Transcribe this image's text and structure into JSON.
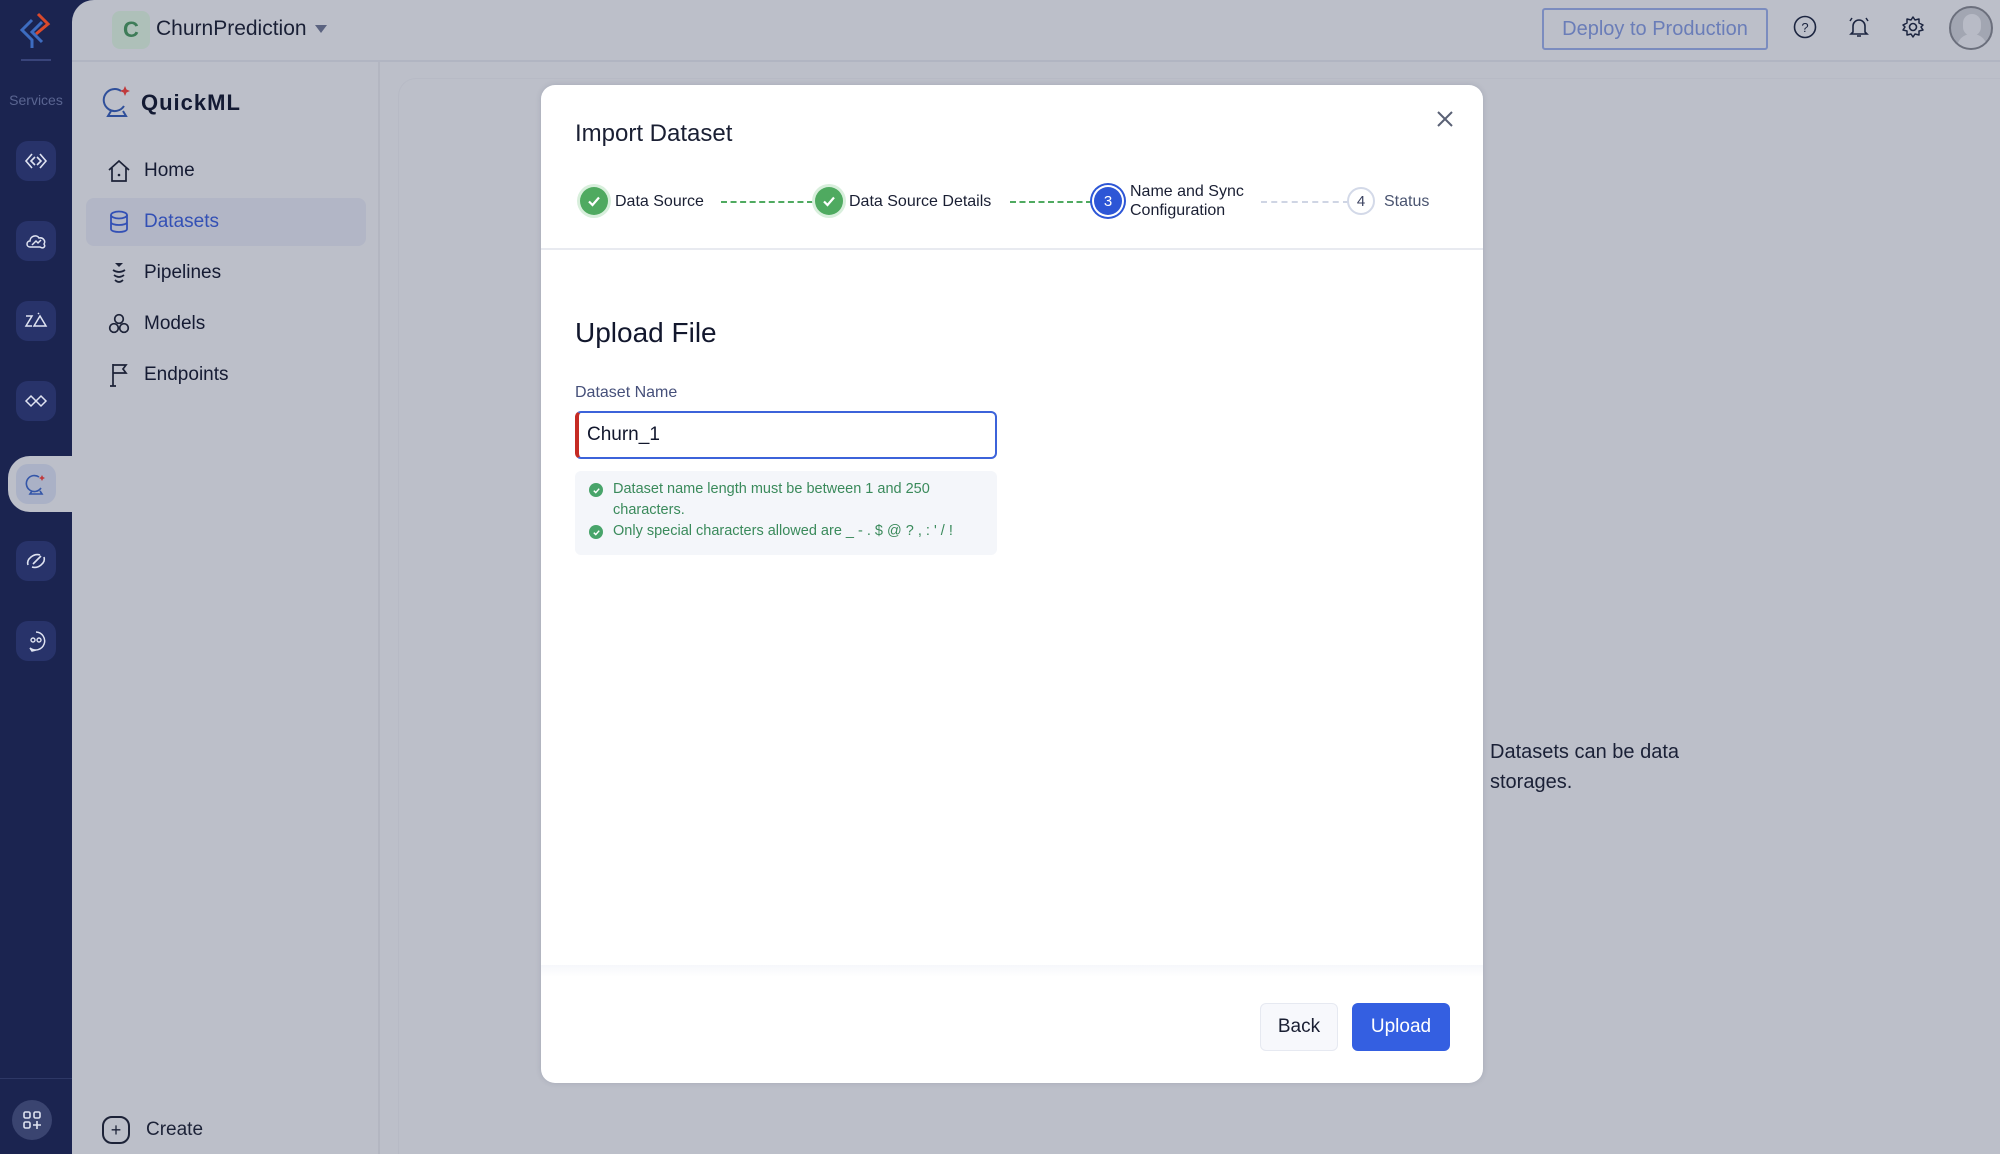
{
  "rail": {
    "services_label": "Services",
    "items": [
      {
        "icon": "code-brackets-icon"
      },
      {
        "icon": "cloud-analytics-icon"
      },
      {
        "icon": "zia-icon"
      },
      {
        "icon": "integration-icon"
      },
      {
        "icon": "quickml-icon",
        "active": true
      },
      {
        "icon": "link-icon"
      },
      {
        "icon": "chat-bot-icon"
      }
    ],
    "apps_icon": "apps-add-icon"
  },
  "topbar": {
    "project_initial": "C",
    "project_name": "ChurnPrediction",
    "deploy_label": "Deploy to Production",
    "icons": [
      "help-icon",
      "bell-icon",
      "gear-icon",
      "avatar"
    ]
  },
  "sidebar": {
    "app_name": "QuickML",
    "items": [
      {
        "label": "Home",
        "icon": "home-icon"
      },
      {
        "label": "Datasets",
        "icon": "database-icon",
        "active": true
      },
      {
        "label": "Pipelines",
        "icon": "pipeline-icon"
      },
      {
        "label": "Models",
        "icon": "models-icon"
      },
      {
        "label": "Endpoints",
        "icon": "flag-icon"
      }
    ],
    "create_label": "Create"
  },
  "background": {
    "hint": "Datasets can be data storages."
  },
  "modal": {
    "title": "Import Dataset",
    "steps": [
      {
        "number": "1",
        "label": "Data Source",
        "state": "done"
      },
      {
        "number": "2",
        "label": "Data Source Details",
        "state": "done"
      },
      {
        "number": "3",
        "label": "Name and Sync Configuration",
        "label_line1": "Name and Sync",
        "label_line2": "Configuration",
        "state": "current"
      },
      {
        "number": "4",
        "label": "Status",
        "state": "todo"
      }
    ],
    "section_title": "Upload File",
    "field_label": "Dataset Name",
    "field_value": "Churn_1",
    "rules": [
      "Dataset name length must be between 1 and 250 characters.",
      "Only special characters allowed are _ - . $ @ ? , : ' / !"
    ],
    "back_label": "Back",
    "upload_label": "Upload"
  },
  "colors": {
    "rail_bg": "#1b2450",
    "accent_blue": "#345fe1",
    "success_green": "#4faa60",
    "error_red": "#c52b24",
    "overlay_bg": "#bcbfc9"
  }
}
